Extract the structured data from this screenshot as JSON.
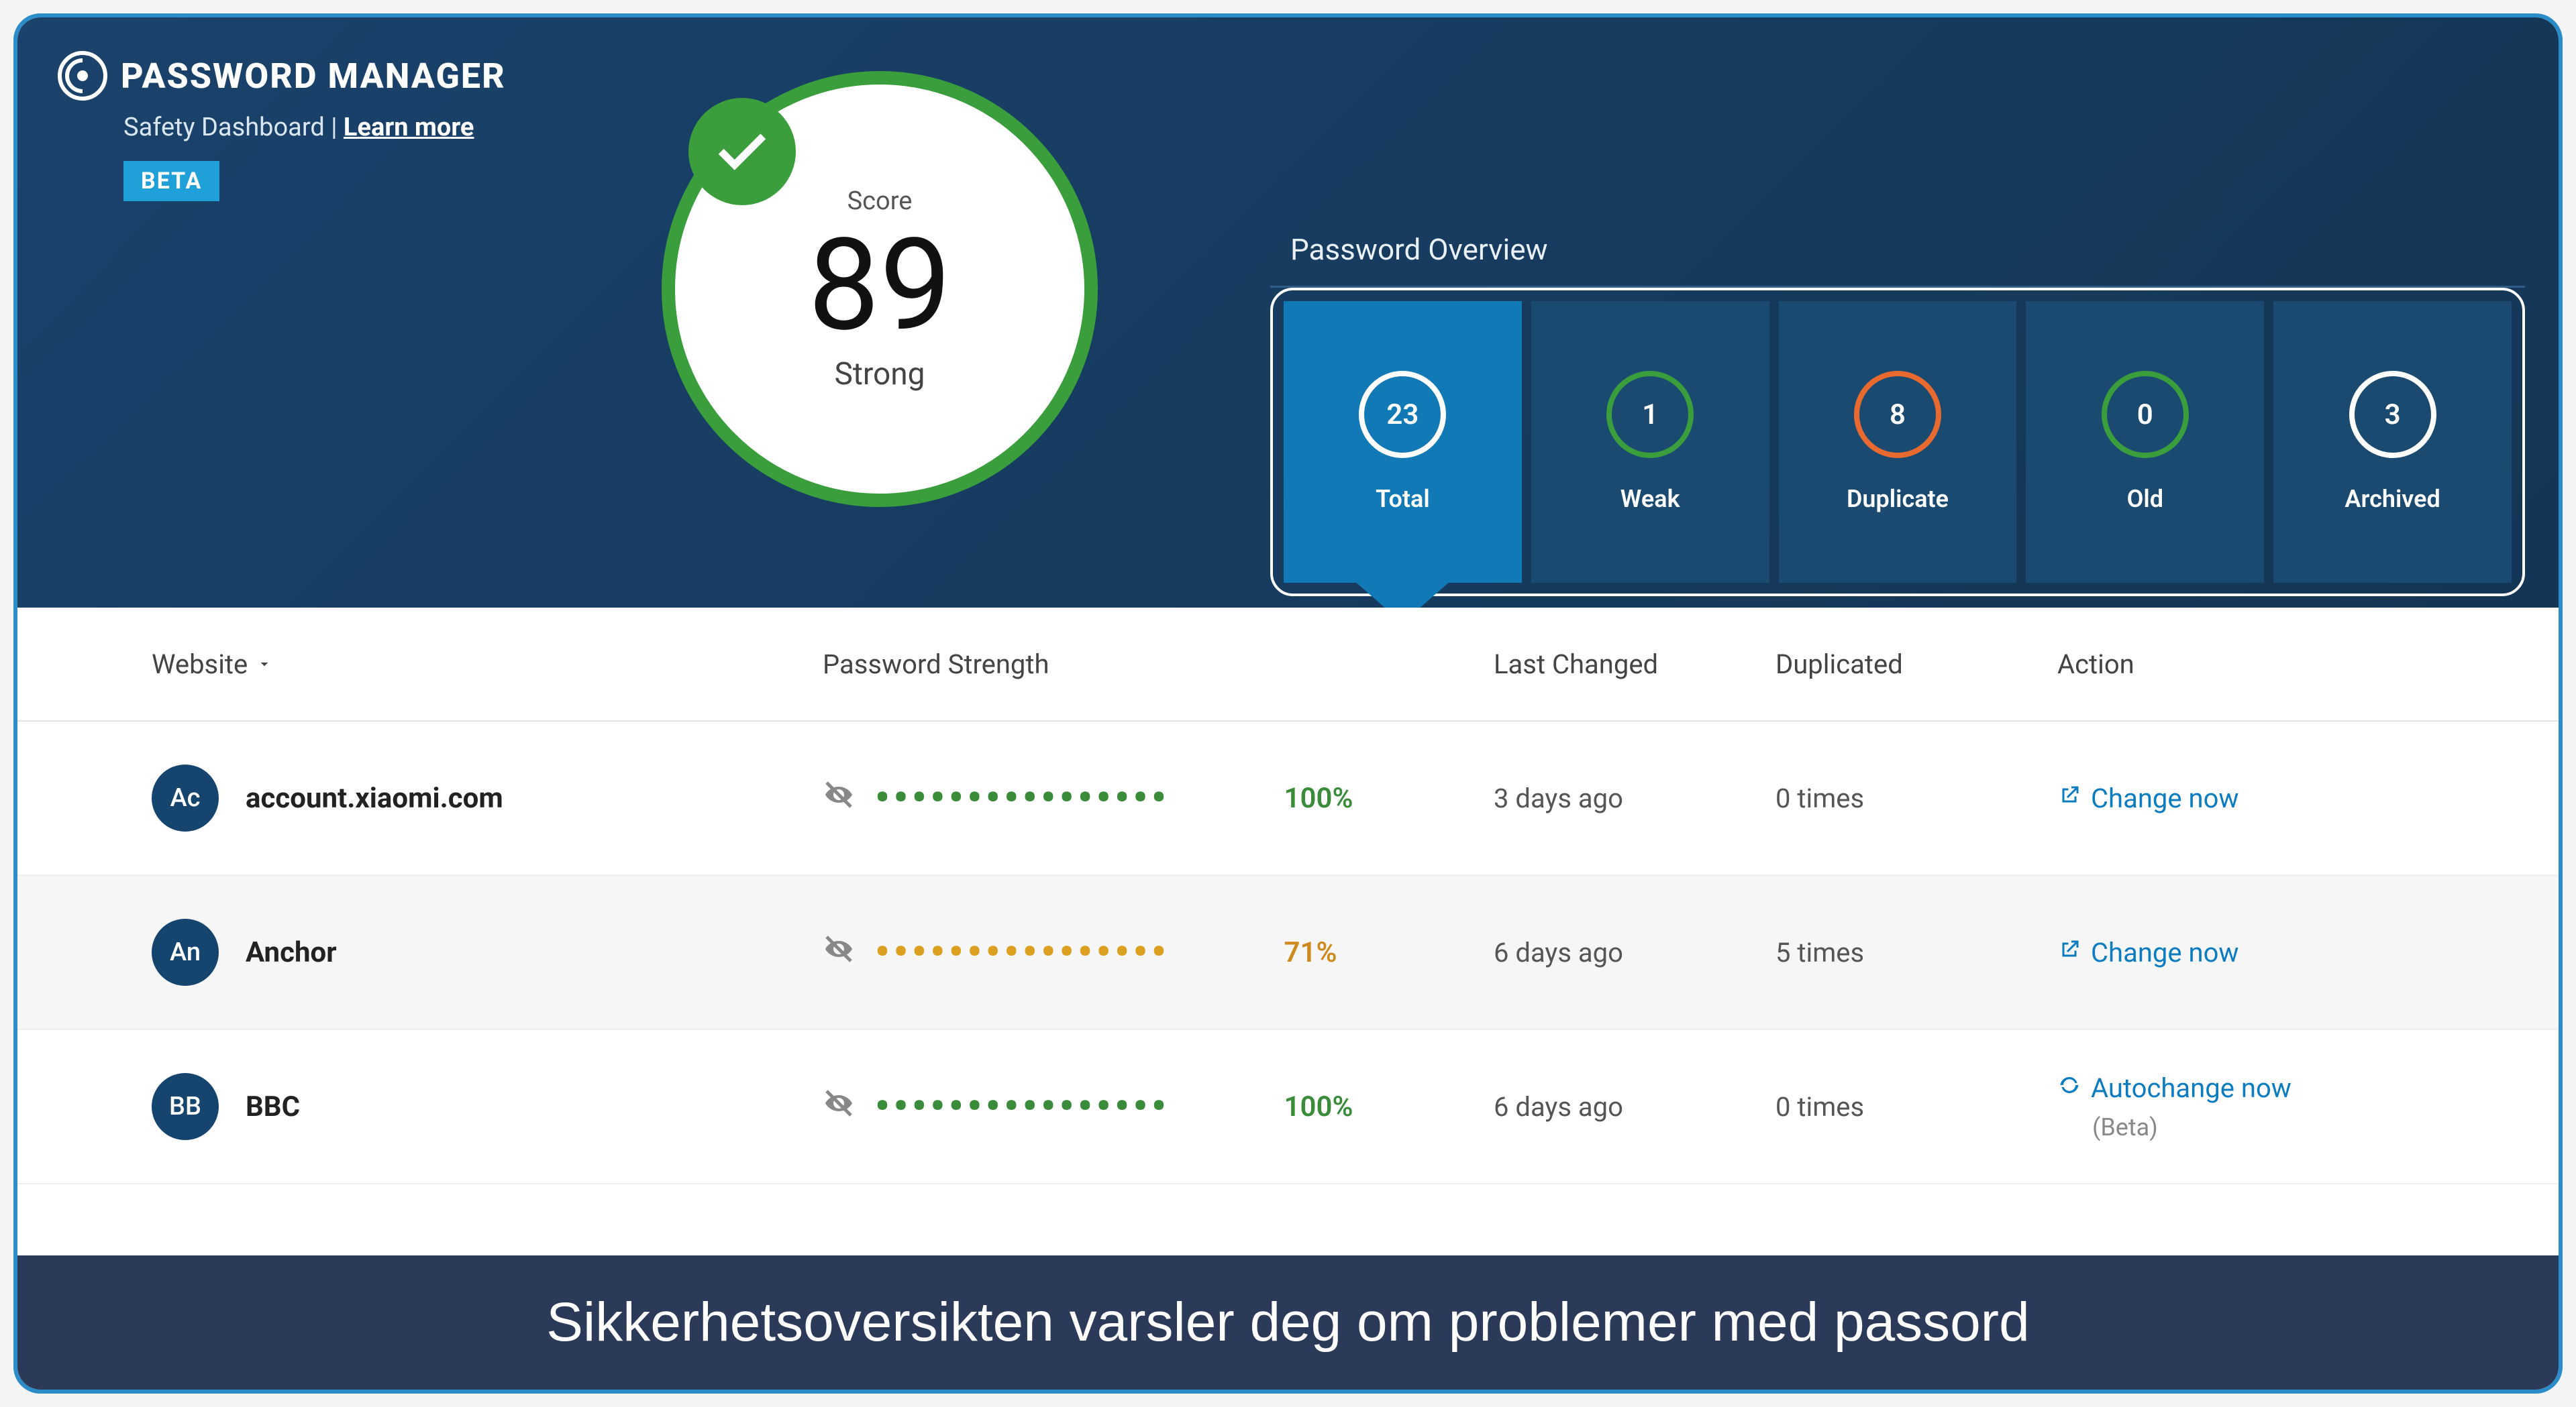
{
  "brand": {
    "title": "PASSWORD MANAGER",
    "subtitle_prefix": "Safety Dashboard | ",
    "learn_more": "Learn more",
    "beta": "BETA"
  },
  "score": {
    "label": "Score",
    "value": "89",
    "rating": "Strong"
  },
  "overview": {
    "title": "Password Overview",
    "cards": [
      {
        "value": "23",
        "label": "Total",
        "ring": "white",
        "active": true
      },
      {
        "value": "1",
        "label": "Weak",
        "ring": "green",
        "active": false
      },
      {
        "value": "8",
        "label": "Duplicate",
        "ring": "orange",
        "active": false
      },
      {
        "value": "0",
        "label": "Old",
        "ring": "green",
        "active": false
      },
      {
        "value": "3",
        "label": "Archived",
        "ring": "white",
        "active": false
      }
    ]
  },
  "columns": {
    "website": "Website",
    "strength": "Password Strength",
    "last": "Last Changed",
    "dup": "Duplicated",
    "action": "Action"
  },
  "rows": [
    {
      "avatar": "Ac",
      "name": "account.xiaomi.com",
      "dots_class": "green",
      "pct": "100%",
      "pct_class": "green",
      "last": "3 days ago",
      "dup": "0 times",
      "action": "Change now",
      "action_icon": "external",
      "action_sub": ""
    },
    {
      "avatar": "An",
      "name": "Anchor",
      "dots_class": "orange",
      "pct": "71%",
      "pct_class": "orange",
      "last": "6 days ago",
      "dup": "5 times",
      "action": "Change now",
      "action_icon": "external",
      "action_sub": ""
    },
    {
      "avatar": "BB",
      "name": "BBC",
      "dots_class": "green",
      "pct": "100%",
      "pct_class": "green",
      "last": "6 days ago",
      "dup": "0 times",
      "action": "Autochange now",
      "action_icon": "refresh",
      "action_sub": "(Beta)"
    }
  ],
  "caption": "Sikkerhetsoversikten varsler deg om problemer med passord"
}
